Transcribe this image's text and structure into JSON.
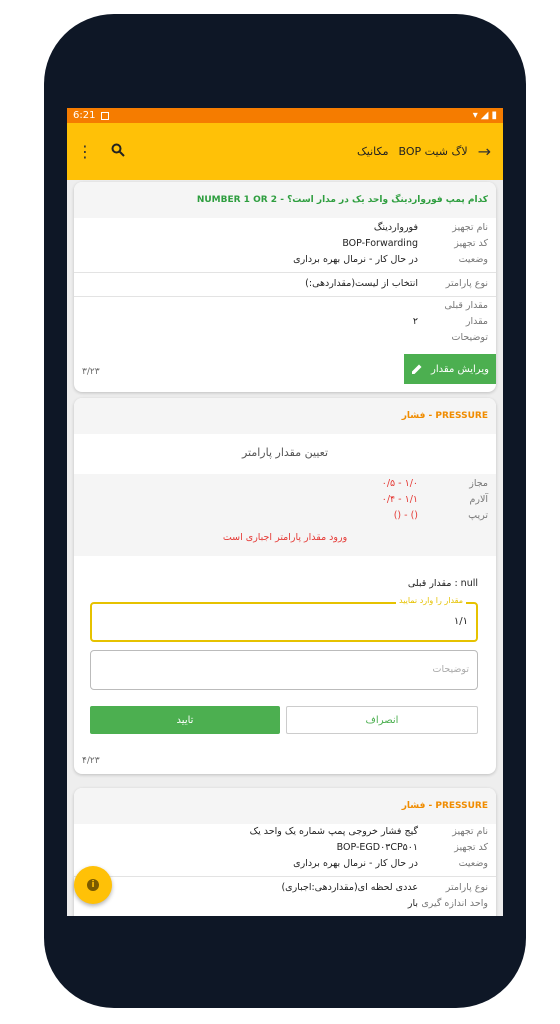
{
  "status": {
    "time": "6:21"
  },
  "appbar": {
    "title": "لاگ شیت BOP",
    "subtitle": "مکانیک"
  },
  "card1": {
    "question": "کدام پمپ فورواردینگ واحد یک در مدار است؟ - NUMBER 1 OR 2",
    "labels": {
      "equipment_name": "نام تجهیز",
      "equipment_code": "کد تجهیز",
      "status": "وضعیت",
      "param_type": "نوع پارامتر",
      "prev_value": "مقدار قبلی",
      "value": "مقدار",
      "description": "توضیحات"
    },
    "equipment_name": "فورواردینگ",
    "equipment_code": "BOP-Forwarding",
    "status_value": "در حال کار - نرمال بهره برداری",
    "param_type_value": "انتخاب از لیست(مقداردهی:)",
    "value": "۲",
    "edit_button": "ویرایش مقدار",
    "page": "۳/۲۳"
  },
  "card2": {
    "title": "فشار - PRESSURE",
    "set_value_title": "تعیین مقدار پارامتر",
    "allowed_label": "مجاز",
    "allowed_value": "۱/۰ - ۰/۵",
    "alarm_label": "آلارم",
    "alarm_value": "۱/۱ - ۰/۴",
    "trip_label": "تریپ",
    "trip_value": "() - ()",
    "required_msg": "ورود مقدار پارامتر اجباری است",
    "prev_value": "مقدار قبلی : null",
    "input_label": "مقدار را وارد نمایید",
    "input_value": "۱/۱",
    "desc_placeholder": "توضیحات",
    "cancel_button": "انصراف",
    "confirm_button": "تایید",
    "page": "۴/۲۳"
  },
  "card3": {
    "title": "فشار - PRESSURE",
    "labels": {
      "equipment_name": "نام تجهیز",
      "equipment_code": "کد تجهیز",
      "status": "وضعیت",
      "param_type": "نوع پارامتر",
      "unit": "واحد اندازه گیری"
    },
    "equipment_name": "گیج فشار خروجی پمپ شماره یک واحد یک",
    "equipment_code": "BOP-EGD۰۳CP۵۰۱",
    "status_value": "در حال کار - نرمال بهره برداری",
    "param_type_value": "عددی لحظه ای(مقداردهی:اجباری)",
    "unit_value": "بار"
  },
  "colors": {
    "accent": "#ffc107",
    "status_bar": "#f57c00",
    "green": "#4caf50",
    "alert": "#e53935",
    "title_orange": "#f08c00",
    "title_green": "#2e9e3f"
  }
}
